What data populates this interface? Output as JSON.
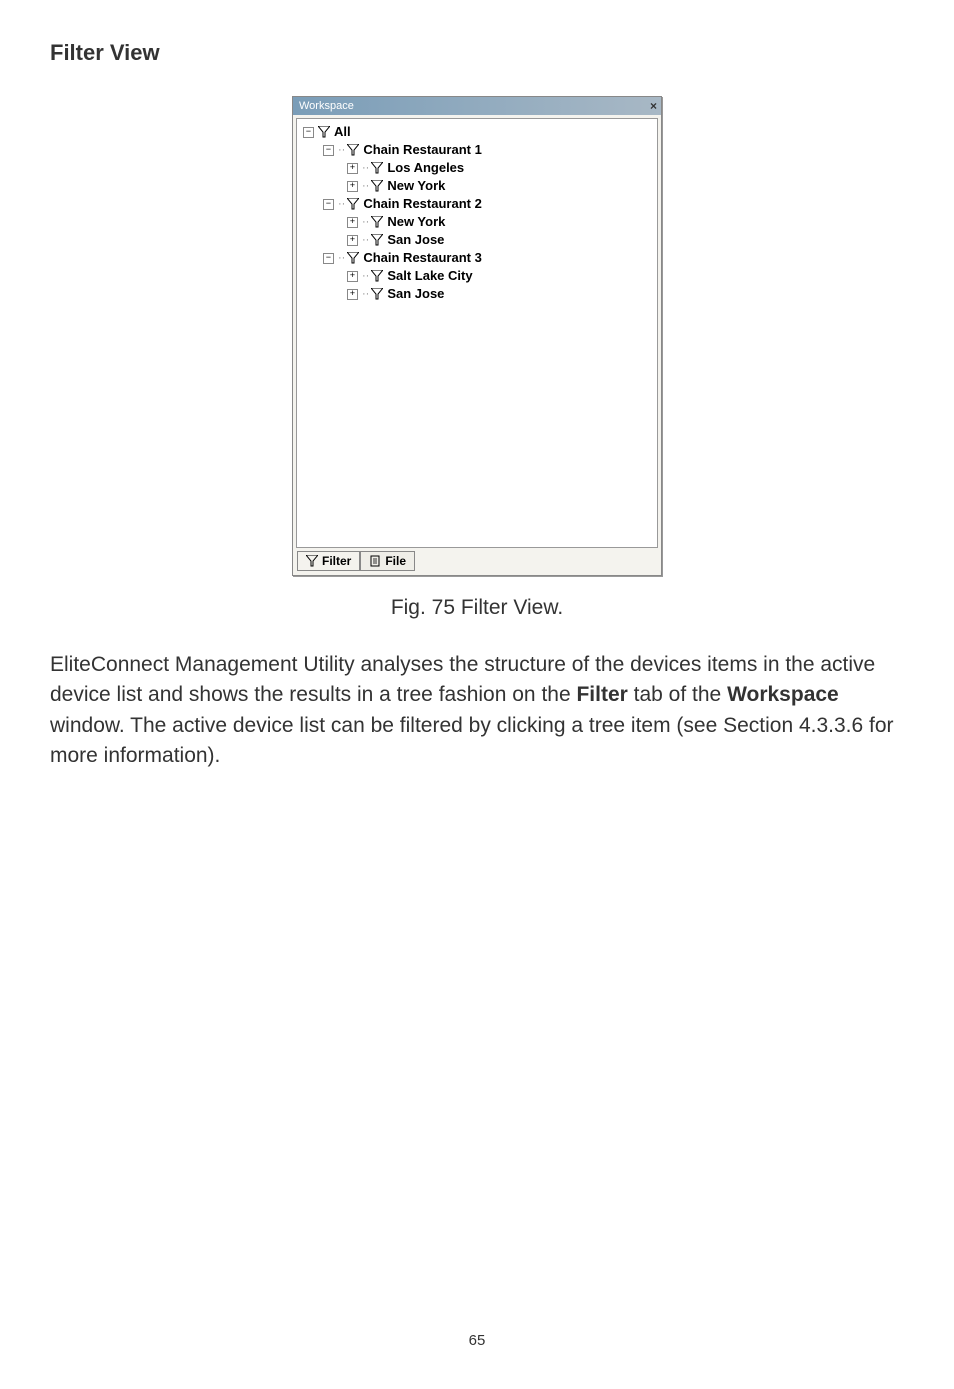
{
  "heading": "Filter View",
  "workspace": {
    "title": "Workspace",
    "close_glyph": "×"
  },
  "tree": {
    "root": {
      "expander": "−",
      "label": "All"
    },
    "nodes": [
      {
        "indent": 1,
        "expander": "−",
        "label": "Chain Restaurant 1"
      },
      {
        "indent": 2,
        "expander": "+",
        "label": "Los Angeles"
      },
      {
        "indent": 2,
        "expander": "+",
        "label": "New York"
      },
      {
        "indent": 1,
        "expander": "−",
        "label": "Chain Restaurant 2"
      },
      {
        "indent": 2,
        "expander": "+",
        "label": "New York"
      },
      {
        "indent": 2,
        "expander": "+",
        "label": "San Jose"
      },
      {
        "indent": 1,
        "expander": "−",
        "label": "Chain Restaurant 3"
      },
      {
        "indent": 2,
        "expander": "+",
        "label": "Salt Lake City"
      },
      {
        "indent": 2,
        "expander": "+",
        "label": "San Jose"
      }
    ]
  },
  "tabs": {
    "filter": "Filter",
    "file": "File"
  },
  "figcaption": "Fig. 75 Filter View.",
  "body": {
    "pre1": "EliteConnect Management Utility analyses the structure of the devices items in the active device list and shows the results in a tree fashion on the ",
    "bold1": "Filter",
    "mid1": " tab of the ",
    "bold2": "Workspace",
    "post1": " window. The active device list can be filtered by clicking a tree item (see Section 4.3.3.6 for more information)."
  },
  "pagenum": "65"
}
